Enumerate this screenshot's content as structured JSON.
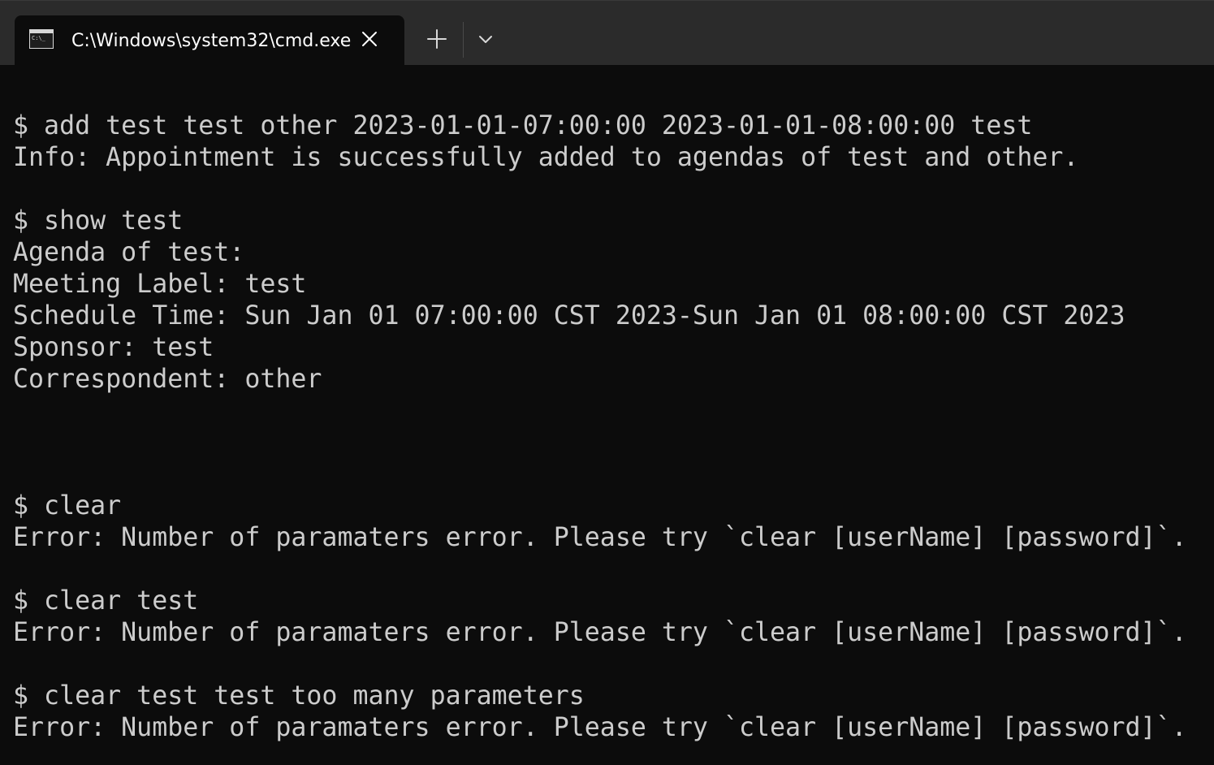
{
  "window": {
    "tab_title": "C:\\Windows\\system32\\cmd.exe",
    "tab_icon": "cmd-icon",
    "close_icon": "close-icon",
    "new_tab_icon": "plus-icon",
    "dropdown_icon": "chevron-down-icon"
  },
  "colors": {
    "background": "#0c0c0c",
    "titlebar": "#2b2b2b",
    "text": "#cccccc"
  },
  "terminal": {
    "lines": [
      "$ add test test other 2023-01-01-07:00:00 2023-01-01-08:00:00 test",
      "Info: Appointment is successfully added to agendas of test and other.",
      "$ show test",
      "Agenda of test:",
      "Meeting Label: test",
      "Schedule Time: Sun Jan 01 07:00:00 CST 2023-Sun Jan 01 08:00:00 CST 2023",
      "Sponsor: test",
      "Correspondent: other",
      "$ clear",
      "Error: Number of paramaters error. Please try `clear [userName] [password]`.",
      "$ clear test",
      "Error: Number of paramaters error. Please try `clear [userName] [password]`.",
      "$ clear test test too many parameters",
      "Error: Number of paramaters error. Please try `clear [userName] [password]`."
    ]
  }
}
